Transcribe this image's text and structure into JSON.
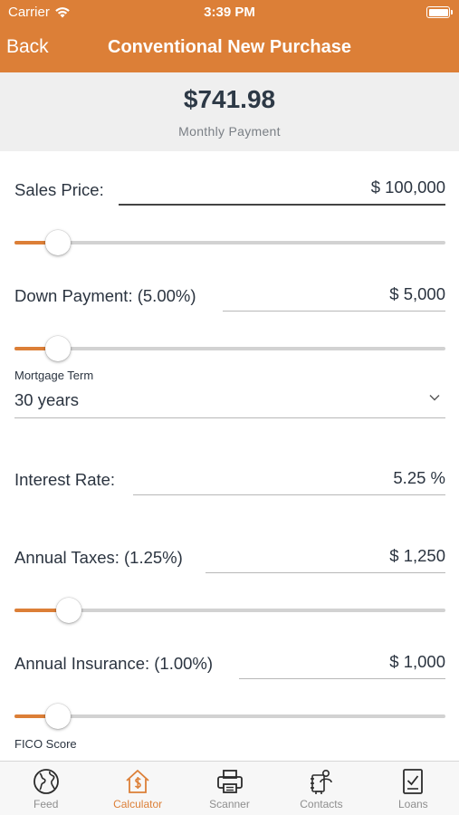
{
  "status_bar": {
    "carrier": "Carrier",
    "time": "3:39 PM"
  },
  "nav": {
    "back_label": "Back",
    "title": "Conventional New Purchase"
  },
  "summary": {
    "amount": "$741.98",
    "label": "Monthly Payment"
  },
  "sales_price": {
    "label": "Sales Price:",
    "value": "$ 100,000",
    "slider_level_percent": 10
  },
  "down_payment": {
    "label": "Down Payment: (5.00%)",
    "value": "$ 5,000",
    "slider_level_percent": 10
  },
  "mortgage_term": {
    "label": "Mortgage Term",
    "selected": "30 years"
  },
  "interest_rate": {
    "label": "Interest Rate:",
    "value": "5.25 %"
  },
  "annual_taxes": {
    "label": "Annual Taxes: (1.25%)",
    "value": "$ 1,250",
    "slider_level_percent": 12.5
  },
  "annual_insurance": {
    "label": "Annual Insurance: (1.00%)",
    "value": "$ 1,000",
    "slider_level_percent": 10
  },
  "fico": {
    "label": "FICO Score"
  },
  "tabs": [
    {
      "label": "Feed",
      "icon": "globe-icon",
      "active": false
    },
    {
      "label": "Calculator",
      "icon": "house-dollar-icon",
      "active": true
    },
    {
      "label": "Scanner",
      "icon": "printer-icon",
      "active": false
    },
    {
      "label": "Contacts",
      "icon": "contacts-icon",
      "active": false
    },
    {
      "label": "Loans",
      "icon": "document-check-icon",
      "active": false
    }
  ],
  "colors": {
    "accent": "#dc7f37",
    "summary_bg": "#efefef",
    "text": "#2b3440"
  }
}
